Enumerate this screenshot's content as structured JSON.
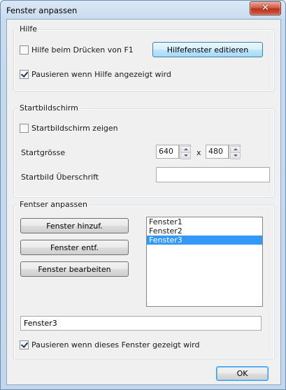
{
  "window": {
    "title": "Fenster anpassen",
    "close_glyph": "✕"
  },
  "help": {
    "legend": "Hilfe",
    "f1_checkbox": {
      "label": "Hilfe beim Drücken von F1",
      "checked": false
    },
    "edit_button": "Hilfefenster editieren",
    "pause_checkbox": {
      "label": "Pausieren wenn Hilfe angezeigt wird",
      "checked": true
    }
  },
  "startscreen": {
    "legend": "Startbildschirm",
    "show_checkbox": {
      "label": "Startbildschirm zeigen",
      "checked": false
    },
    "size_label": "Startgrösse",
    "width_value": "640",
    "times": "x",
    "height_value": "480",
    "caption_label": "Startbild Überschrift",
    "caption_value": ""
  },
  "windows": {
    "legend": "Fentser anpassen",
    "add_button": "Fenster hinzuf.",
    "remove_button": "Fenster entf.",
    "edit_button": "Fenster bearbeiten",
    "list": [
      "Fenster1",
      "Fenster2",
      "Fenster3"
    ],
    "selected": "Fenster3",
    "name_value": "Fenster3",
    "pause_checkbox": {
      "label": "Pausieren wenn dieses Fenster gezeigt wird",
      "checked": true
    }
  },
  "footer": {
    "ok_button": "OK"
  },
  "colors": {
    "selection": "#3399ff",
    "close": "#c9442c"
  }
}
